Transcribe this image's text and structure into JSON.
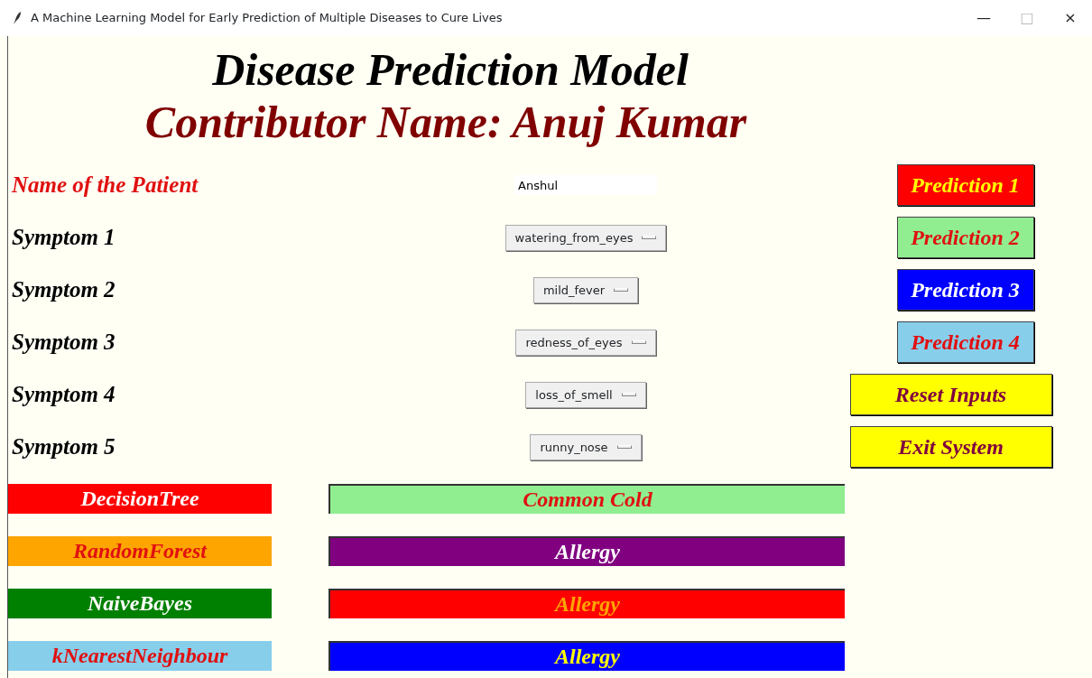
{
  "window": {
    "title": "A Machine Learning Model for Early Prediction of Multiple Diseases to Cure Lives",
    "controls": [
      "—",
      "□",
      "×"
    ]
  },
  "heading": {
    "title": "Disease Prediction Model",
    "subtitle": "Contributor Name: Anuj Kumar"
  },
  "patient": {
    "label": "Name of the Patient",
    "value": "Anshul"
  },
  "symptoms": [
    {
      "label": "Symptom 1",
      "value": "watering_from_eyes"
    },
    {
      "label": "Symptom 2",
      "value": "mild_fever"
    },
    {
      "label": "Symptom 3",
      "value": "redness_of_eyes"
    },
    {
      "label": "Symptom 4",
      "value": "loss_of_smell"
    },
    {
      "label": "Symptom 5",
      "value": "runny_nose"
    }
  ],
  "buttons": [
    {
      "kind": "small",
      "fill": {
        "color": "#ff0000"
      },
      "label": {
        "text": "Prediction 1",
        "color": "#ffff00"
      }
    },
    {
      "kind": "small",
      "fill": {
        "color": "#90ee90"
      },
      "label": {
        "text": "Prediction 2",
        "color": "#e01010"
      }
    },
    {
      "kind": "small",
      "fill": {
        "color": "#0000ff"
      },
      "label": {
        "text": "Prediction 3",
        "color": "#ffffff"
      }
    },
    {
      "kind": "small",
      "fill": {
        "color": "#87ceeb"
      },
      "label": {
        "text": "Prediction 4",
        "color": "#e01010"
      }
    },
    {
      "kind": "wide",
      "fill": {
        "color": "#ffff00"
      },
      "label": {
        "text": "Reset Inputs",
        "color": "#800040"
      }
    },
    {
      "kind": "wide",
      "fill": {
        "color": "#ffff00"
      },
      "label": {
        "text": "Exit System",
        "color": "#800040"
      }
    }
  ],
  "results": [
    {
      "model": {
        "fill": {
          "color": "#ff0000"
        },
        "label": {
          "text": "DecisionTree",
          "color": "#ffffff"
        }
      },
      "prediction": {
        "fill": {
          "color": "#90ee90"
        },
        "label": {
          "text": "Common Cold",
          "color": "#e01010"
        }
      }
    },
    {
      "model": {
        "fill": {
          "color": "#ffa500"
        },
        "label": {
          "text": "RandomForest",
          "color": "#e01010"
        }
      },
      "prediction": {
        "fill": {
          "color": "#800080"
        },
        "label": {
          "text": "Allergy",
          "color": "#ffffff"
        }
      }
    },
    {
      "model": {
        "fill": {
          "color": "#008000"
        },
        "label": {
          "text": "NaiveBayes",
          "color": "#ffffff"
        }
      },
      "prediction": {
        "fill": {
          "color": "#ff0000"
        },
        "label": {
          "text": "Allergy",
          "color": "#ffa500"
        }
      }
    },
    {
      "model": {
        "fill": {
          "color": "#87ceeb"
        },
        "label": {
          "text": "kNearestNeighbour",
          "color": "#e01010"
        }
      },
      "prediction": {
        "fill": {
          "color": "#0000ff"
        },
        "label": {
          "text": "Allergy",
          "color": "#ffff00"
        }
      }
    }
  ]
}
